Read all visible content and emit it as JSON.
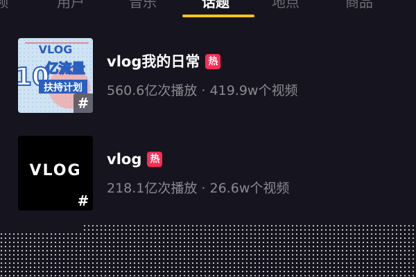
{
  "tabs": [
    {
      "label": "频",
      "active": false
    },
    {
      "label": "用户",
      "active": false
    },
    {
      "label": "音乐",
      "active": false
    },
    {
      "label": "话题",
      "active": true
    },
    {
      "label": "地点",
      "active": false
    },
    {
      "label": "商品",
      "active": false
    }
  ],
  "topics": [
    {
      "title": "vlog我的日常",
      "hot_badge": "热",
      "stats": "560.6亿次播放 · 419.9w个视频",
      "thumbnail": {
        "type": "poster",
        "lines": [
          "VLOG",
          "10",
          "亿流量",
          "扶持计划"
        ],
        "hash_icon": "#"
      }
    },
    {
      "title": "vlog",
      "hot_badge": "热",
      "stats": "218.1亿次播放 · 26.6w个视频",
      "thumbnail": {
        "type": "text",
        "text": "VLOG",
        "hash_icon": "#"
      }
    }
  ],
  "colors": {
    "background": "#16151f",
    "active_tab_underline": "#f5c518",
    "hot_badge": "#fe2c55",
    "title": "#ffffff",
    "muted": "#8a8a93"
  }
}
